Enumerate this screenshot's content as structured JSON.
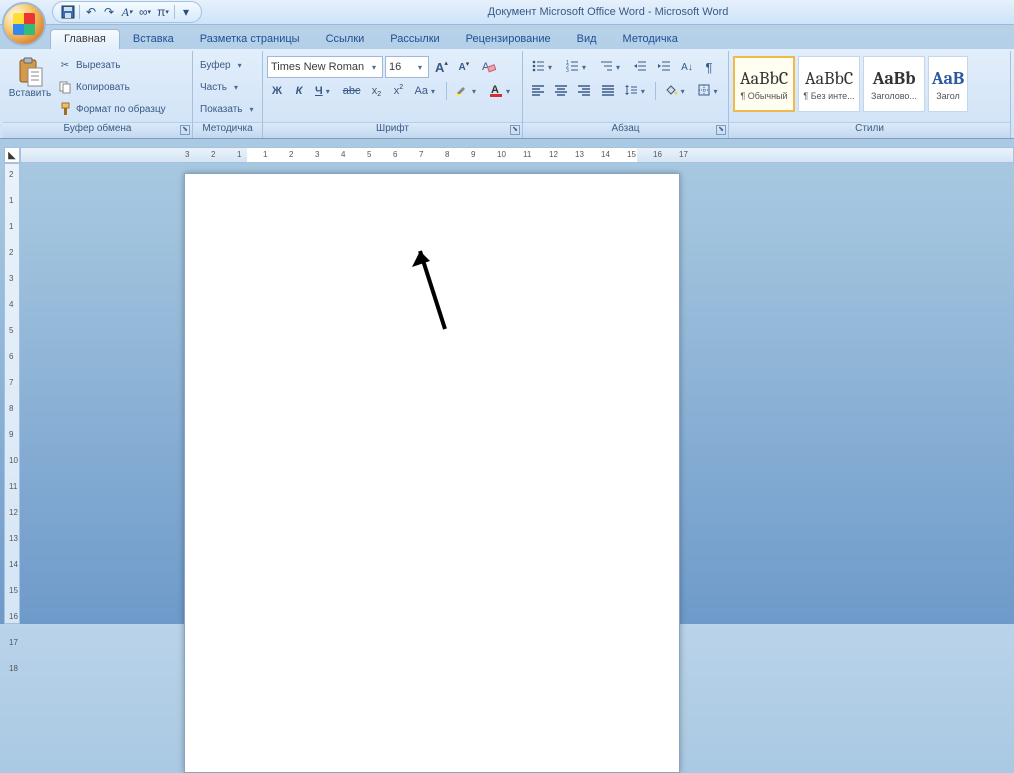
{
  "title": "Документ Microsoft Office Word - Microsoft Word",
  "qat": {
    "more": "▾"
  },
  "tabs": [
    "Главная",
    "Вставка",
    "Разметка страницы",
    "Ссылки",
    "Рассылки",
    "Рецензирование",
    "Вид",
    "Методичка"
  ],
  "clipboard": {
    "paste": "Вставить",
    "cut": "Вырезать",
    "copy": "Копировать",
    "format_painter": "Формат по образцу",
    "title": "Буфер обмена"
  },
  "metod": {
    "buffer": "Буфер",
    "part": "Часть",
    "show": "Показать",
    "title": "Методичка"
  },
  "font": {
    "name": "Times New Roman",
    "size": "16",
    "bold": "Ж",
    "italic": "К",
    "underline": "Ч",
    "strike": "abc",
    "sub": "x",
    "sup": "x",
    "case": "Aa",
    "grow": "A",
    "shrink": "A",
    "clear": "A",
    "title": "Шрифт"
  },
  "para": {
    "title": "Абзац"
  },
  "styles": {
    "s1": {
      "preview": "AaBbC",
      "name": "¶ Обычный"
    },
    "s2": {
      "preview": "AaBbC",
      "name": "¶ Без инте..."
    },
    "s3": {
      "preview": "AaBb",
      "name": "Заголово..."
    },
    "s4": {
      "preview": "AaB",
      "name": "Загол"
    },
    "title": "Стили"
  },
  "ruler": {
    "marks": [
      "3",
      "2",
      "1",
      "1",
      "2",
      "3",
      "4",
      "5",
      "6",
      "7",
      "8",
      "9",
      "10",
      "11",
      "12",
      "13",
      "14",
      "15",
      "16",
      "17"
    ]
  },
  "vruler": {
    "marks": [
      "2",
      "1",
      "1",
      "2",
      "3",
      "4",
      "5",
      "6",
      "7",
      "8",
      "9",
      "10",
      "11",
      "12",
      "13",
      "14",
      "15",
      "16",
      "17",
      "18"
    ]
  }
}
